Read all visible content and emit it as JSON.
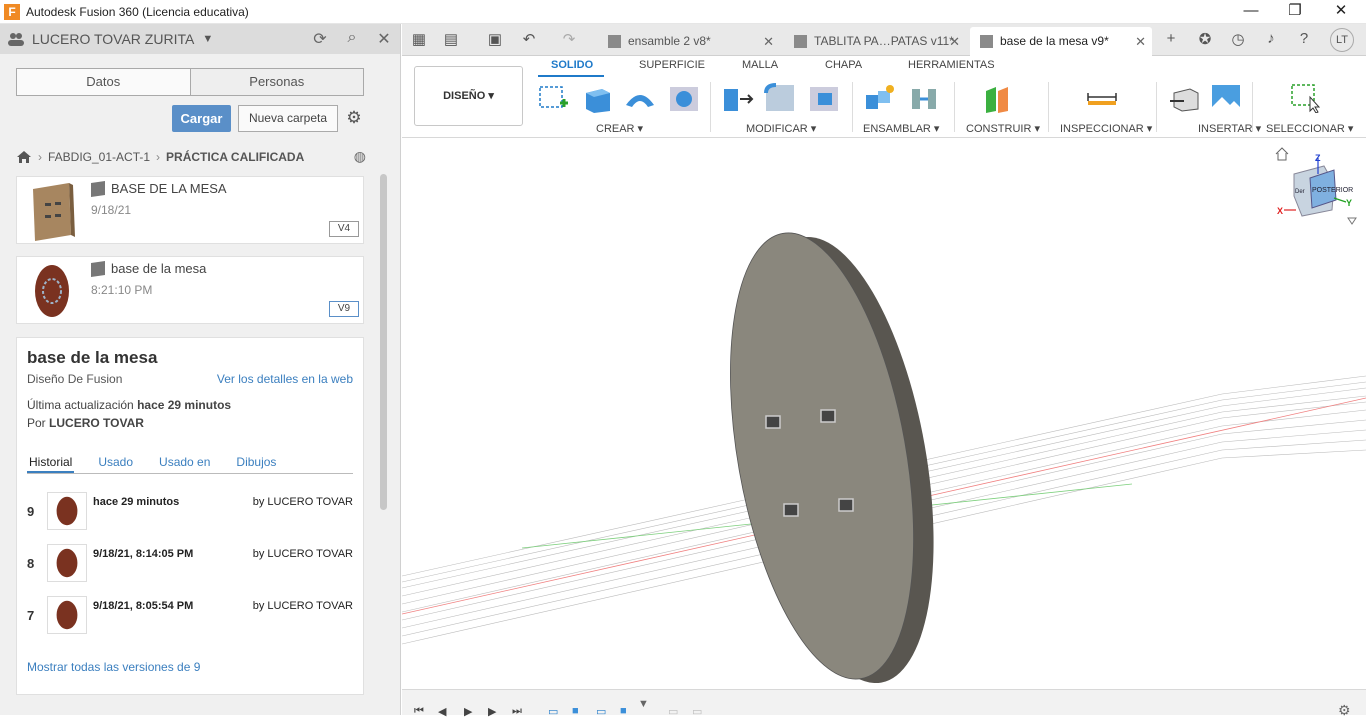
{
  "app": {
    "title": "Autodesk Fusion 360 (Licencia educativa)",
    "logo_letter": "F"
  },
  "window_controls": {
    "minimize": "—",
    "restore": "❐",
    "close": "✕"
  },
  "panel": {
    "user": "LUCERO TOVAR ZURITA",
    "seg_datos": "Datos",
    "seg_personas": "Personas",
    "btn_cargar": "Cargar",
    "btn_nueva": "Nueva carpeta",
    "breadcrumb": [
      "FABDIG_01-ACT-1",
      "PRÁCTICA CALIFICADA"
    ],
    "files": [
      {
        "name": "BASE DE LA MESA",
        "date": "9/18/21",
        "version": "V4"
      },
      {
        "name": "base de la mesa",
        "date": "8:21:10 PM",
        "version": "V9"
      }
    ],
    "details": {
      "title": "base de la mesa",
      "subtitle": "Diseño De Fusion",
      "link": "Ver los detalles en la web",
      "updated_label": "Última actualización",
      "updated_value": "hace 29 minutos",
      "by_label": "Por",
      "by_value": "LUCERO TOVAR",
      "tabs": [
        "Historial",
        "Usado",
        "Usado en",
        "Dibujos"
      ],
      "history": [
        {
          "num": "9",
          "date": "hace 29 minutos",
          "by": "by LUCERO TOVAR"
        },
        {
          "num": "8",
          "date": "9/18/21, 8:14:05 PM",
          "by": "by LUCERO TOVAR"
        },
        {
          "num": "7",
          "date": "9/18/21, 8:05:54 PM",
          "by": "by LUCERO TOVAR"
        }
      ],
      "show_all": "Mostrar todas las versiones de 9"
    }
  },
  "tabs": [
    {
      "label": "ensamble 2 v8*"
    },
    {
      "label": "TABLITA PA…PATAS v11*"
    },
    {
      "label": "base de la mesa v9*"
    }
  ],
  "user_initials": "LT",
  "ribbon": {
    "workspace": "DISEÑO ▾",
    "tabs": [
      "SOLIDO",
      "SUPERFICIE",
      "MALLA",
      "CHAPA",
      "HERRAMIENTAS"
    ],
    "groups": [
      "CREAR ▾",
      "MODIFICAR ▾",
      "ENSAMBLAR ▾",
      "CONSTRUIR ▾",
      "INSPECCIONAR ▾",
      "INSERTAR ▾",
      "SELECCIONAR ▾"
    ]
  },
  "viewcube": {
    "face": "POSTERIOR",
    "side": "Der",
    "axis_z": "Z",
    "axis_x": "X",
    "axis_y": "Y"
  },
  "colors": {
    "accent": "#1f7ac9",
    "button": "#5a8fc8",
    "link": "#3b7fbf",
    "model": "#8a877d"
  }
}
